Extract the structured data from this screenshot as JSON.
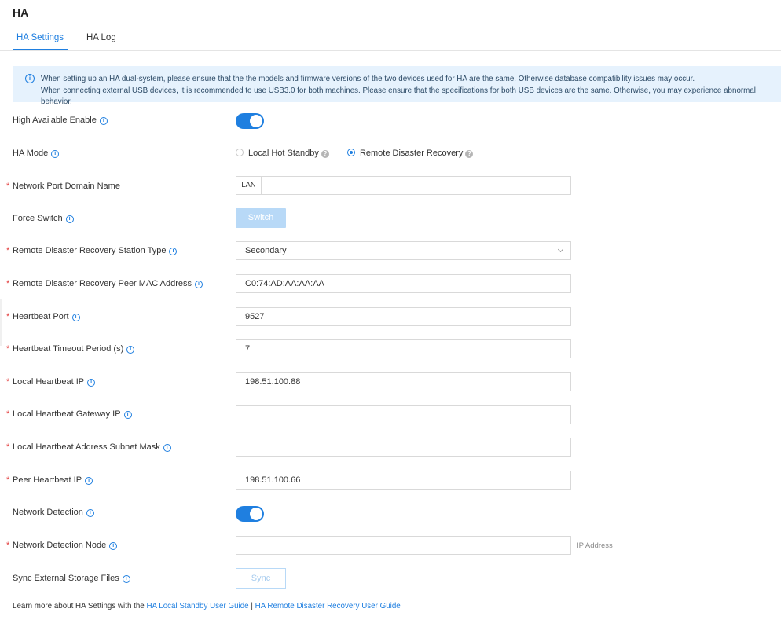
{
  "page": {
    "title": "HA"
  },
  "tabs": [
    {
      "label": "HA Settings",
      "active": true
    },
    {
      "label": "HA Log",
      "active": false
    }
  ],
  "banner": {
    "line1": "When setting up an HA dual-system, please ensure that the the models and firmware versions of the two devices used for HA are the same. Otherwise database compatibility issues may occur.",
    "line2": "When connecting external USB devices, it is recommended to use USB3.0 for both machines. Please ensure that the specifications for both USB devices are the same. Otherwise, you may experience abnormal behavior."
  },
  "fields": {
    "ha_enable": {
      "label": "High Available Enable",
      "enabled": true
    },
    "ha_mode": {
      "label": "HA Mode",
      "options": [
        "Local Hot Standby",
        "Remote Disaster Recovery"
      ],
      "selected": "Remote Disaster Recovery"
    },
    "domain_name": {
      "label": "Network Port Domain Name",
      "addon": "LAN",
      "value": ""
    },
    "force_switch": {
      "label": "Force Switch",
      "button": "Switch"
    },
    "station_type": {
      "label": "Remote Disaster Recovery Station Type",
      "value": "Secondary"
    },
    "peer_mac": {
      "label": "Remote Disaster Recovery Peer MAC Address",
      "value": "C0:74:AD:AA:AA:AA"
    },
    "heartbeat_port": {
      "label": "Heartbeat Port",
      "value": "9527"
    },
    "heartbeat_timeout": {
      "label": "Heartbeat Timeout Period (s)",
      "value": "7"
    },
    "local_ip": {
      "label": "Local Heartbeat IP",
      "value": "198.51.100.88"
    },
    "local_gateway": {
      "label": "Local Heartbeat Gateway IP",
      "value": ""
    },
    "subnet_mask": {
      "label": "Local Heartbeat Address Subnet Mask",
      "value": ""
    },
    "peer_ip": {
      "label": "Peer Heartbeat IP",
      "value": "198.51.100.66"
    },
    "network_detection": {
      "label": "Network Detection",
      "enabled": true
    },
    "detection_node": {
      "label": "Network Detection Node",
      "value": "",
      "suffix": "IP Address"
    },
    "sync_storage": {
      "label": "Sync External Storage Files",
      "button": "Sync"
    }
  },
  "footer": {
    "prefix": "Learn more about HA Settings with the ",
    "link1": "HA Local Standby User Guide",
    "separator": " | ",
    "link2": "HA Remote Disaster Recovery User Guide"
  },
  "colors": {
    "accent": "#1f7fe0",
    "banner_bg": "#e6f2fd",
    "required": "#e23b3b"
  }
}
